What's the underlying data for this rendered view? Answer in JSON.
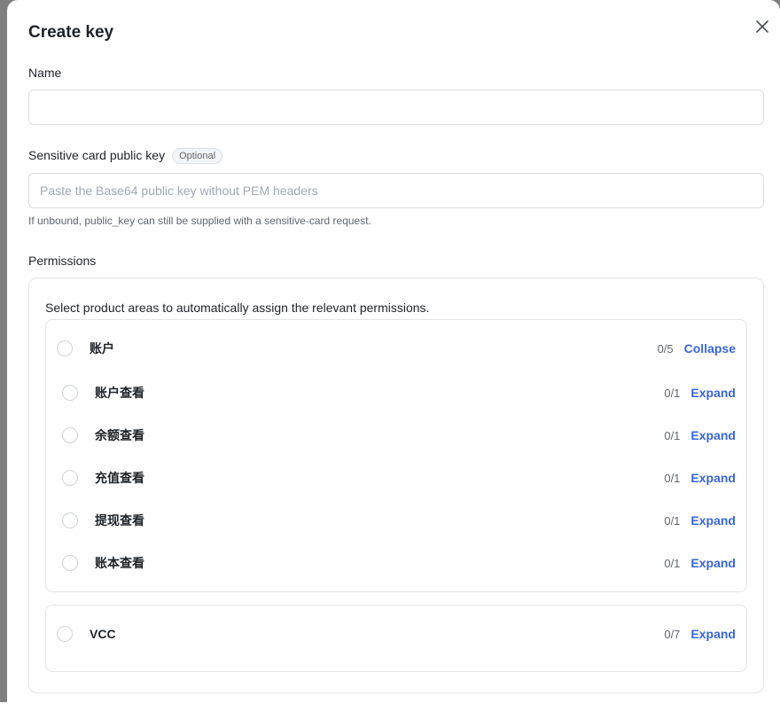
{
  "modal": {
    "title": "Create key",
    "close_icon": "close-icon"
  },
  "form": {
    "name": {
      "label": "Name",
      "value": "",
      "placeholder": ""
    },
    "public_key": {
      "label": "Sensitive card public key",
      "badge": "Optional",
      "value": "",
      "placeholder": "Paste the Base64 public key without PEM headers",
      "helper": "If unbound, public_key can still be supplied with a sensitive-card request."
    }
  },
  "permissions": {
    "label": "Permissions",
    "description": "Select product areas to automatically assign the relevant permissions.",
    "groups": [
      {
        "label": "账户",
        "count": "0/5",
        "toggle": "Collapse",
        "items": [
          {
            "label": "账户查看",
            "count": "0/1",
            "toggle": "Expand"
          },
          {
            "label": "余额查看",
            "count": "0/1",
            "toggle": "Expand"
          },
          {
            "label": "充值查看",
            "count": "0/1",
            "toggle": "Expand"
          },
          {
            "label": "提现查看",
            "count": "0/1",
            "toggle": "Expand"
          },
          {
            "label": "账本查看",
            "count": "0/1",
            "toggle": "Expand"
          }
        ]
      },
      {
        "label": "VCC",
        "count": "0/7",
        "toggle": "Expand",
        "items": []
      }
    ]
  },
  "colors": {
    "accent": "#3867d6",
    "border": "#e2e5e9",
    "backdrop": "#7f7f7f"
  }
}
